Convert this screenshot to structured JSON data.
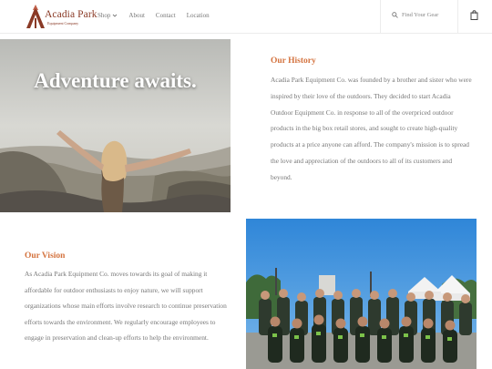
{
  "header": {
    "logo_name": "Acadia Park",
    "logo_sub": "Equipment Company",
    "nav": [
      {
        "label": "Shop",
        "has_dropdown": true
      },
      {
        "label": "About",
        "has_dropdown": false
      },
      {
        "label": "Contact",
        "has_dropdown": false
      },
      {
        "label": "Location",
        "has_dropdown": false
      }
    ],
    "search_placeholder": "Find Your Gear",
    "icons": {
      "search": "search-icon",
      "bag": "shopping-bag-icon",
      "dropdown": "chevron-down-icon"
    }
  },
  "hero": {
    "title": "Adventure awaits."
  },
  "history": {
    "title": "Our History",
    "body": "Acadia Park Equipment Co. was founded by a brother and sister who were inspired by their love of the outdoors. They decided to start Acadia Outdoor Equipment Co. in response to all of the overpriced outdoor products in the big box retail stores, and sought to create high-quality products at a price anyone can afford. The company's mission is to spread the love and appreciation of the outdoors to all of its customers and beyond."
  },
  "vision": {
    "title": "Our Vision",
    "body": "As Acadia Park Equipment Co. moves towards its goal of making it affordable for outdoor enthusiasts to enjoy nature, we will support organizations whose main efforts involve research to continue preservation efforts towards the environment. We regularly encourage employees to engage in preservation and clean-up efforts to help the environment."
  },
  "colors": {
    "accent": "#d4733f",
    "brand": "#8a3a26",
    "body_text": "#777777"
  }
}
